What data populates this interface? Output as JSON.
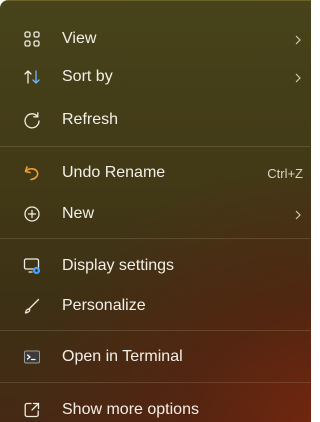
{
  "context_menu": {
    "items": [
      {
        "id": "view",
        "label": "View",
        "icon": "grid-icon",
        "submenu": true
      },
      {
        "id": "sort",
        "label": "Sort by",
        "icon": "sort-arrows-icon",
        "submenu": true
      },
      {
        "id": "refresh",
        "label": "Refresh",
        "icon": "refresh-icon",
        "submenu": false
      },
      {
        "id": "undo",
        "label": "Undo Rename",
        "icon": "undo-icon",
        "shortcut": "Ctrl+Z"
      },
      {
        "id": "new",
        "label": "New",
        "icon": "plus-circle-icon",
        "submenu": true
      },
      {
        "id": "display",
        "label": "Display settings",
        "icon": "display-settings-icon"
      },
      {
        "id": "personalize",
        "label": "Personalize",
        "icon": "brush-icon"
      },
      {
        "id": "terminal",
        "label": "Open in Terminal",
        "icon": "terminal-icon"
      },
      {
        "id": "more",
        "label": "Show more options",
        "icon": "share-icon"
      }
    ]
  },
  "colors": {
    "undo_icon": "#f0a030",
    "settings_gear": "#4aa3ff"
  }
}
